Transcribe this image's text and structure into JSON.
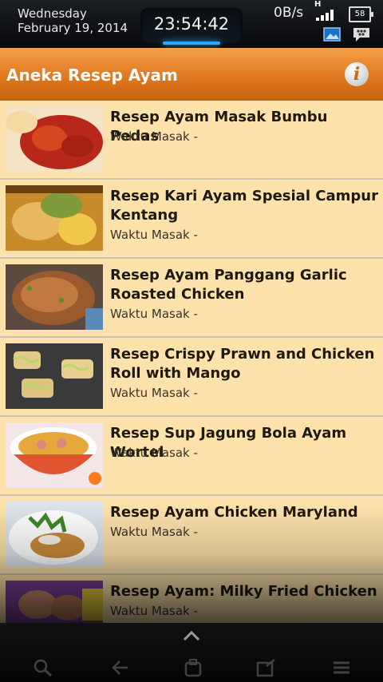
{
  "status_bar": {
    "day": "Wednesday",
    "date": "February 19, 2014",
    "time": "23:54:42",
    "network_speed": "0B/s",
    "network_type": "H",
    "battery": "58"
  },
  "header": {
    "title": "Aneka Resep Ayam",
    "info_icon": "info-icon"
  },
  "recipes": [
    {
      "name": "Resep Ayam Masak Bumbu Pedas",
      "time_label": "Waktu Masak -"
    },
    {
      "name": "Resep Kari Ayam Spesial Campur Kentang",
      "time_label": "Waktu Masak -"
    },
    {
      "name": "Resep Ayam Panggang Garlic Roasted Chicken",
      "time_label": "Waktu Masak -"
    },
    {
      "name": "Resep Crispy Prawn and Chicken Roll with Mango",
      "time_label": "Waktu Masak -"
    },
    {
      "name": "Resep Sup Jagung Bola Ayam Wortel",
      "time_label": "Waktu Masak -"
    },
    {
      "name": "Resep Ayam Chicken Maryland",
      "time_label": "Waktu Masak -"
    },
    {
      "name": "Resep Ayam: Milky Fried Chicken",
      "time_label": "Waktu Masak -"
    }
  ],
  "nav": {
    "icons": [
      "chevron-up-icon",
      "search-icon",
      "back-icon",
      "home-icon",
      "menu-icon"
    ]
  },
  "colors": {
    "header": "#e0781e",
    "list_bg": "#fce1aa",
    "clock_glow": "#2aa7ff"
  }
}
